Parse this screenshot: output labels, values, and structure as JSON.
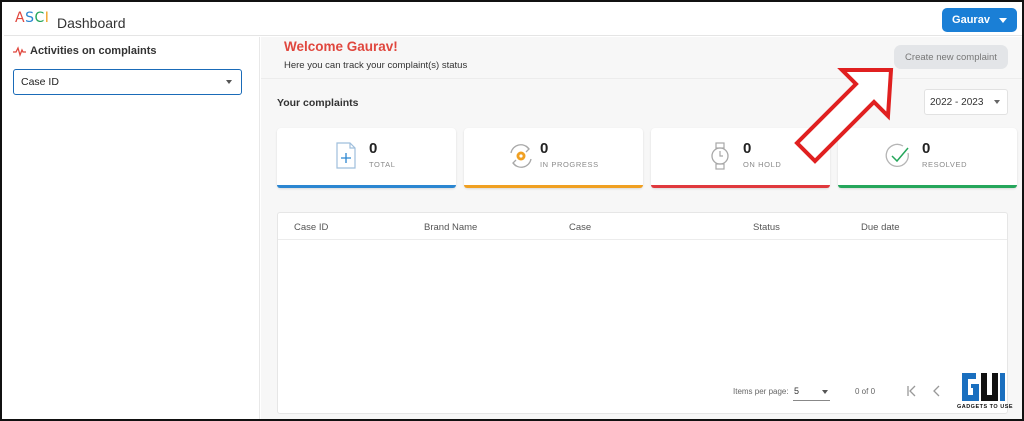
{
  "header": {
    "logo_text": "ASCI",
    "title": "Dashboard",
    "user_button": "Gaurav"
  },
  "sidebar": {
    "heading": "Activities on complaints",
    "filter_value": "Case ID"
  },
  "welcome": {
    "title": "Welcome Gaurav!",
    "subtitle": "Here you can track your complaint(s) status",
    "create_button": "Create new complaint"
  },
  "complaints": {
    "label": "Your complaints",
    "year": "2022 - 2023",
    "cards": [
      {
        "count": "0",
        "label": "TOTAL",
        "color": "#2b86d1",
        "icon": "document-plus-icon"
      },
      {
        "count": "0",
        "label": "IN PROGRESS",
        "color": "#f0a022",
        "icon": "refresh-gear-icon"
      },
      {
        "count": "0",
        "label": "ON HOLD",
        "color": "#e0393d",
        "icon": "watch-icon"
      },
      {
        "count": "0",
        "label": "RESOLVED",
        "color": "#25a65b",
        "icon": "check-circle-icon"
      }
    ]
  },
  "table": {
    "columns": [
      "Case ID",
      "Brand Name",
      "Case",
      "Status",
      "Due date"
    ],
    "rows": []
  },
  "pagination": {
    "items_per_page_label": "Items per page:",
    "items_per_page": "5",
    "range": "0 of 0"
  },
  "watermark": {
    "text": "GADGETS TO USE"
  },
  "colors": {
    "accent": "#1a7fd6",
    "welcome_red": "#e0473e",
    "annotation_arrow": "#e02020"
  }
}
